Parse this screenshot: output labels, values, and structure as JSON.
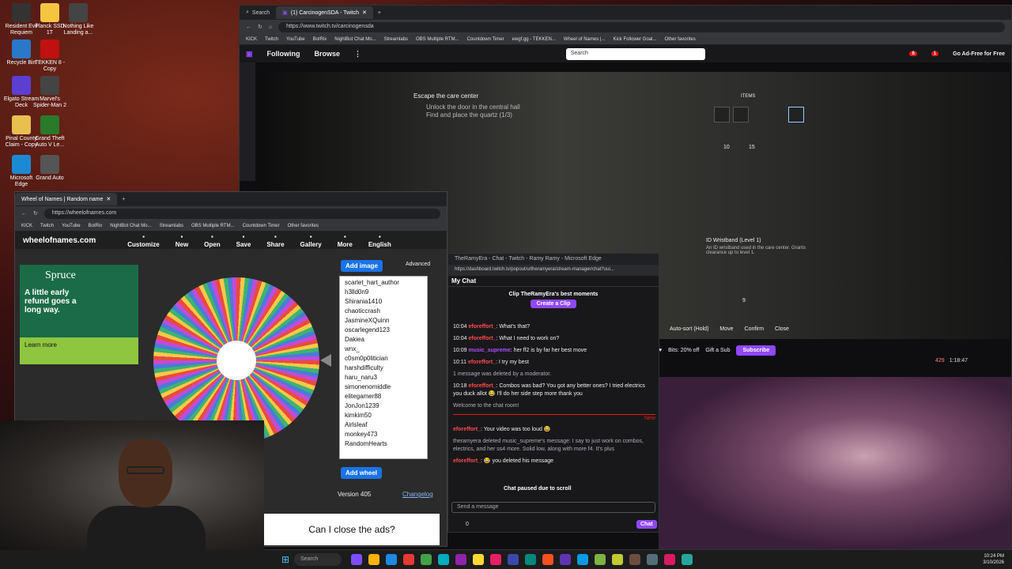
{
  "desktop": {
    "icons": [
      {
        "label": "Resident Evil Requiem",
        "color": "#333"
      },
      {
        "label": "Planck SSD 1T",
        "color": "#f5c542"
      },
      {
        "label": "Nothing Like Landing a...",
        "color": "#444"
      },
      {
        "label": "Recycle Bin",
        "color": "#2a78c8"
      },
      {
        "label": "TEKKEN 8 - Copy",
        "color": "#c01010"
      },
      {
        "label": "Elgato Stream Deck",
        "color": "#5a3fd0"
      },
      {
        "label": "Marvel's Spider-Man 2",
        "color": "#444"
      },
      {
        "label": "Pinal County Claim - Copy",
        "color": "#e8c050"
      },
      {
        "label": "Grand Theft Auto V Le...",
        "color": "#2a7a2a"
      },
      {
        "label": "Microsoft Edge",
        "color": "#1a8ad4"
      },
      {
        "label": "Grand Auto",
        "color": "#555"
      }
    ]
  },
  "twitch": {
    "tabs": [
      "Search",
      "(1) CarcinogenSDA - Twitch"
    ],
    "url": "https://www.twitch.tv/carcinogensda",
    "bookmarks": [
      "KICK",
      "Twitch",
      "YouTube",
      "BotRix",
      "NightBot Chat Mo...",
      "Streamlabs",
      "OBS Multiple RTM...",
      "Countdown Timer",
      "ewgf.gg - TEKKEN...",
      "Wheel of Names |...",
      "Kick Follower Goal...",
      "Other favorites"
    ],
    "nav": {
      "following": "Following",
      "browse": "Browse",
      "search_placeholder": "Search",
      "ad_free": "Go Ad-Free for Free",
      "notif_count": "8",
      "whisper_count": "1"
    },
    "game": {
      "objective": "Escape the care center",
      "sub1": "Unlock the door in the central hall",
      "sub2": "Find and place the quartz (1/3)",
      "items_label": "ITEMS",
      "count1": "10",
      "count2": "15",
      "count3": "9",
      "item_name": "ID Wristband (Level 1)",
      "item_desc": "An ID wristband used in the care center. Grants clearance up to level 1.",
      "actions": [
        "Auto-sort (Hold)",
        "Move",
        "Confirm",
        "Close"
      ]
    },
    "bar": {
      "bits": "Bits: 20% off",
      "gift": "Gift a Sub",
      "subscribe": "Subscribe",
      "viewers": "429",
      "uptime": "1:18:47"
    }
  },
  "wheel": {
    "tab_title": "Wheel of Names | Random name",
    "url": "https://wheelofnames.com",
    "bookmarks": [
      "KICK",
      "Twitch",
      "YouTube",
      "BotRix",
      "NightBot Chat Mo...",
      "Streamlabs",
      "OBS Multiple RTM...",
      "Countdown Timer",
      "Other favorites"
    ],
    "logo": "wheelofnames.com",
    "toolbar": [
      "Customize",
      "New",
      "Open",
      "Save",
      "Share",
      "Gallery",
      "More",
      "English"
    ],
    "ad": {
      "brand": "Spruce",
      "headline": "A little early refund goes a long way.",
      "learn": "Learn more"
    },
    "add_image": "Add image",
    "advanced": "Advanced",
    "names": [
      "scarlet_hart_author",
      "h3lld0n9",
      "Shirania1410",
      "chaoticcrash",
      "JasmineXQuinn",
      "oscarlegend123",
      "Dakiea",
      "wnx_",
      "c0sm0p0litician",
      "harshdifficulty",
      "haru_naru3",
      "simonenomiddle",
      "elitegamer88",
      "JonJon1239",
      "kimkim50",
      "Airlsleaf",
      "monkey473",
      "RandomHearts"
    ],
    "add_wheel": "Add wheel",
    "version": "Version 405",
    "changelog": "Changelog"
  },
  "chat": {
    "title": "TheRamyEra - Chat - Twitch - Ramy Ramy - Microsoft Edge",
    "url": "https://dashboard.twitch.tv/popout/u/theramyera/stream-manager/chat?uui...",
    "header": "My Chat",
    "clip_text": "Clip TheRamyEra's best moments",
    "clip_btn": "Create a Clip",
    "messages": [
      {
        "time": "10:04",
        "user": "eforeffort_",
        "text": ": What's that?",
        "cls": "uname"
      },
      {
        "time": "10:04",
        "user": "eforeffort_",
        "text": ": What I need to work on?",
        "cls": "uname"
      },
      {
        "time": "10:09",
        "user": "music_supreme",
        "text": ": her ff2 is by far her best move",
        "cls": "uname2"
      },
      {
        "time": "10:11",
        "user": "eforeffort_",
        "text": ": I try my best",
        "cls": "uname"
      },
      {
        "time": "",
        "user": "",
        "text": "1 message was deleted by a moderator.",
        "cls": "sys"
      },
      {
        "time": "10:18",
        "user": "eforeffort_",
        "text": ": Combos was bad? You got any better ones? I tried electrics you duck allot 😂 I'll do her side step more thank you",
        "cls": "uname"
      },
      {
        "time": "",
        "user": "",
        "text": "Welcome to the chat room!",
        "cls": "sys"
      },
      {
        "time": "",
        "user": "eforeffort_",
        "text": ": Your video was too loud 😂",
        "cls": "uname"
      },
      {
        "time": "",
        "user": "",
        "text": "theramyera deleted music_supreme's message: I say to just work on combos, electrics, and her ss4 more. Solid low, along with more f4. It's plus",
        "cls": "sys"
      },
      {
        "time": "",
        "user": "eforeffort_",
        "text": ": 😂 you deleted his message",
        "cls": "uname"
      }
    ],
    "new_label": "New",
    "paused": "Chat paused due to scroll",
    "input_placeholder": "Send a message",
    "points": "0",
    "chat_btn": "Chat"
  },
  "caption": "Can I close the ads?",
  "taskbar": {
    "search": "Search",
    "time": "10:24 PM",
    "date": "3/10/2026"
  }
}
